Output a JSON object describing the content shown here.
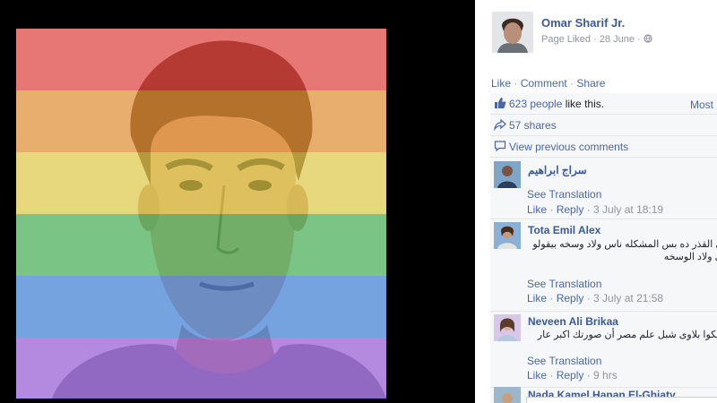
{
  "page": {
    "name": "Omar Sharif Jr.",
    "meta": "Page Liked · 28 June ·",
    "globe_icon": "globe-icon"
  },
  "actions": {
    "like": "Like",
    "comment": "Comment",
    "share": "Share"
  },
  "likes": {
    "count_text": "623 people",
    "suffix": " like this.",
    "sort_label": "Most R"
  },
  "shares": {
    "text": "57 shares"
  },
  "previous_comments": {
    "text": "View previous comments"
  },
  "comments": [
    {
      "name": "سراج ابراهيم",
      "text": "",
      "translate": "See Translation",
      "like": "Like",
      "reply": "Reply",
      "time": "3 July at 18:19"
    },
    {
      "name": "Tota Emil Alex",
      "text": "يه المشكله مش فى القذر ده بس المشكله ناس ولاد وسخه بيقولو مبروك ، مبروك على ولاد الوسخه",
      "translate": "See Translation",
      "like": "Like",
      "reply": "Reply",
      "time": "3 July at 21:58"
    },
    {
      "name": "Neveen Ali Brikaa",
      "text": "ا الله ونعم الوكيل فيكوا بلاوى شبل علم مصر أن صورتك اكبر عار جنبة وموسخة",
      "translate": "See Translation",
      "like": "Like",
      "reply": "Reply",
      "time": "9 hrs"
    },
    {
      "name": "Nada Kamel Hanan El-Ghiaty"
    }
  ],
  "colors": {
    "rainbow": [
      "#ff3b3b",
      "#ff9f2e",
      "#ffe94a",
      "#38c85a",
      "#2f8bff",
      "#a25bff"
    ],
    "link": "#4b67a1",
    "name": "#3b5998"
  }
}
